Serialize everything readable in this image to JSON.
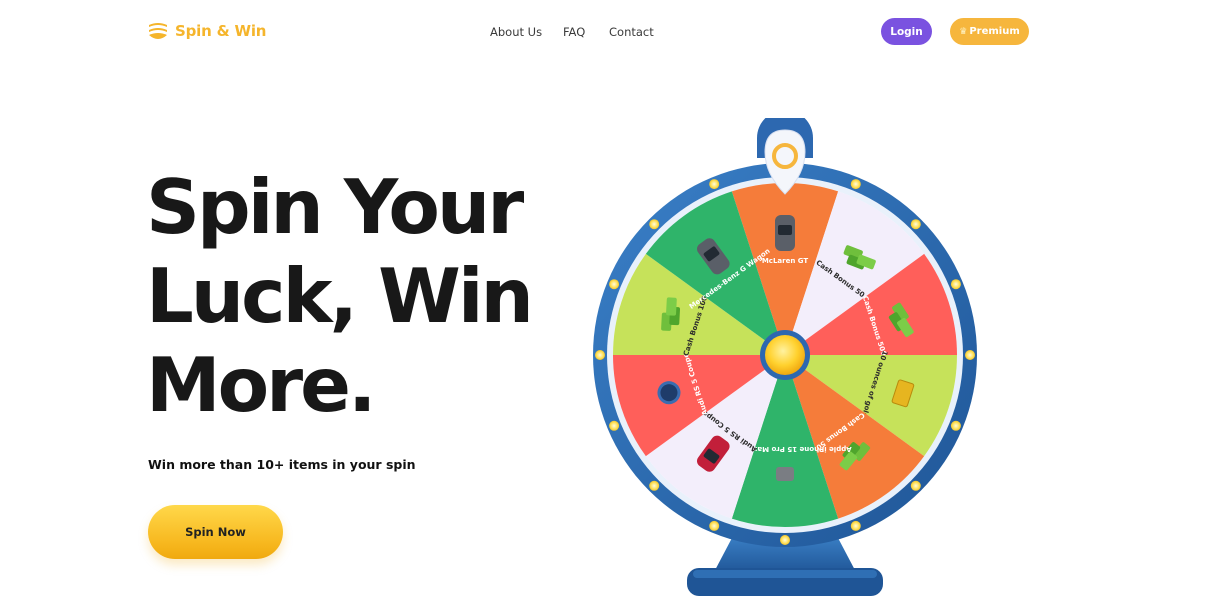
{
  "header": {
    "logo_text": "Spin & Win",
    "nav": [
      {
        "label": "About Us"
      },
      {
        "label": "FAQ"
      },
      {
        "label": "Contact"
      }
    ],
    "login_label": "Login",
    "premium_label": "Premium"
  },
  "hero": {
    "headline_lines": [
      "Spin Your",
      "Luck, Win",
      "More."
    ],
    "subtitle": "Win more than 10+ items in your spin",
    "cta_label": "Spin Now"
  },
  "wheel": {
    "segments": [
      {
        "label": "McLaren GT",
        "color": "#f57c3a",
        "icon": "car-icon"
      },
      {
        "label": "Cash Bonus 50",
        "color": "#f3eefb",
        "icon": "cash-icon"
      },
      {
        "label": "Cash Bonus 500",
        "color": "#ff5f5a",
        "icon": "cash-icon"
      },
      {
        "label": "10 ounces of gold",
        "color": "#c6e25a",
        "icon": "gold-bar-icon"
      },
      {
        "label": "Cash Bonus 50",
        "color": "#f57c3a",
        "icon": "cash-icon"
      },
      {
        "label": "Apple iPhone 15 Pro Max (256GB)",
        "color": "#2fb46a",
        "icon": "phone-icon"
      },
      {
        "label": "Audi RS 5 Coupe",
        "color": "#f3eefb",
        "icon": "car-icon"
      },
      {
        "label": "Audi RS 5 Coupe",
        "color": "#ff5f5a",
        "icon": "watch-icon"
      },
      {
        "label": "Cash Bonus 100",
        "color": "#c6e25a",
        "icon": "cash-icon"
      },
      {
        "label": "Mercedes-Benz G Wagon",
        "color": "#2fb46a",
        "icon": "car-icon"
      }
    ],
    "colors": {
      "rim": "#2d68b0",
      "rim_dark": "#1d4f8f",
      "light": "#ffe680",
      "hub": "#ffcc22",
      "brand": "#f5b52c"
    }
  }
}
